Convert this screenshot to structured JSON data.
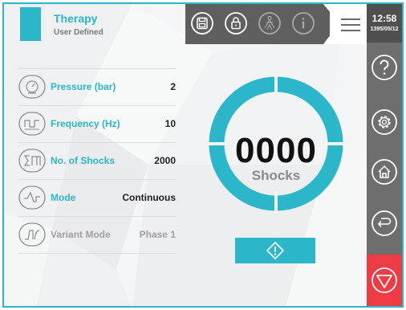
{
  "header": {
    "title": "Therapy",
    "subtitle": "User Defined"
  },
  "toolbar": {
    "icons": [
      "save-icon",
      "lock-icon",
      "body-icon",
      "info-icon",
      "menu-icon"
    ]
  },
  "status": {
    "time": "12:58",
    "date": "1395/05/12"
  },
  "sidebar_right": {
    "icons": [
      "help-icon",
      "settings-icon",
      "home-icon",
      "back-icon",
      "stop-icon"
    ]
  },
  "params": [
    {
      "label": "Pressure (bar)",
      "value": "2",
      "icon": "pressure-gauge-icon",
      "enabled": true
    },
    {
      "label": "Frequency (Hz)",
      "value": "10",
      "icon": "frequency-wave-icon",
      "enabled": true
    },
    {
      "label": "No. of Shocks",
      "value": "2000",
      "icon": "shocks-sum-icon",
      "enabled": true
    },
    {
      "label": "Mode",
      "value": "Continuous",
      "icon": "mode-wave-icon",
      "enabled": true
    },
    {
      "label": "Variant Mode",
      "value": "Phase 1",
      "icon": "variant-wave-icon",
      "enabled": false
    }
  ],
  "counter": {
    "value": "0000",
    "unit": "Shocks"
  },
  "colors": {
    "accent": "#2bb7c9",
    "stop": "#ee3b44",
    "panel": "#6e6e6e",
    "toolbar": "#5f5f5f"
  }
}
